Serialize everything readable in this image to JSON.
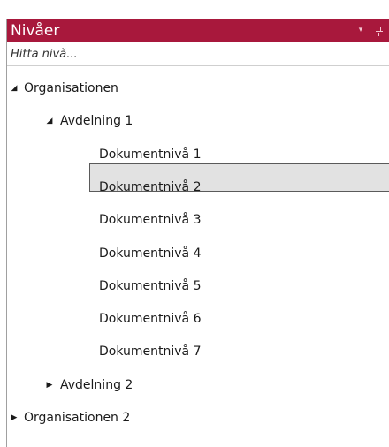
{
  "panel": {
    "title": "Nivåer",
    "dropdown_icon": "▾",
    "pin_icon": "pin-icon"
  },
  "search": {
    "placeholder": "Hitta nivå..."
  },
  "tree": {
    "expanded_icon": "◢",
    "collapsed_icon": "▶",
    "nodes": [
      {
        "label": "Organisationen",
        "level": 0,
        "state": "expanded"
      },
      {
        "label": "Avdelning 1",
        "level": 1,
        "state": "expanded"
      },
      {
        "label": "Dokumentnivå 1",
        "level": 2,
        "state": "leaf",
        "selected": true
      },
      {
        "label": "Dokumentnivå 2",
        "level": 2,
        "state": "leaf"
      },
      {
        "label": "Dokumentnivå 3",
        "level": 2,
        "state": "leaf"
      },
      {
        "label": "Dokumentnivå 4",
        "level": 2,
        "state": "leaf"
      },
      {
        "label": "Dokumentnivå 5",
        "level": 2,
        "state": "leaf"
      },
      {
        "label": "Dokumentnivå 6",
        "level": 2,
        "state": "leaf"
      },
      {
        "label": "Dokumentnivå 7",
        "level": 2,
        "state": "leaf"
      },
      {
        "label": "Avdelning 2",
        "level": 1,
        "state": "collapsed"
      },
      {
        "label": "Organisationen 2",
        "level": 0,
        "state": "collapsed"
      }
    ]
  },
  "colors": {
    "title_bar": "#a8183c",
    "selection_fill": "#e2e2e2",
    "selection_border": "#5a5a5a"
  }
}
